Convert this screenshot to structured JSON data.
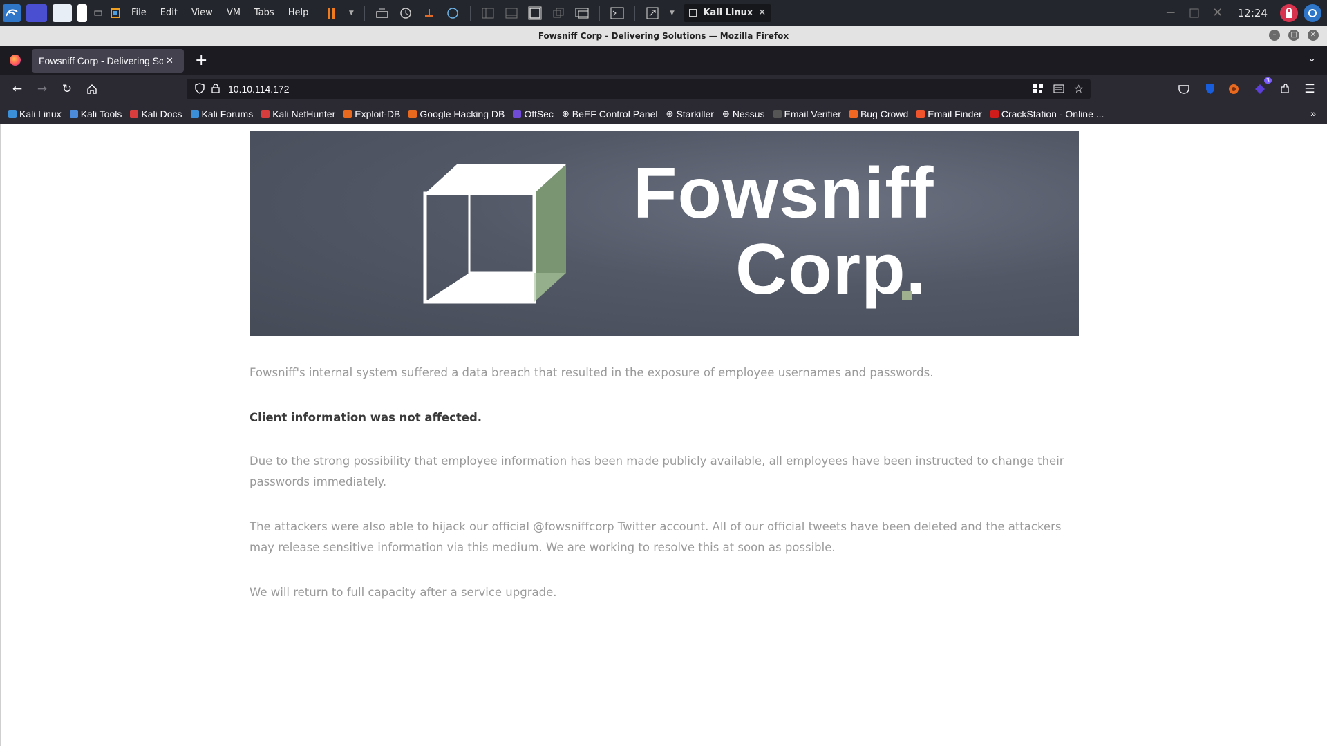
{
  "vm": {
    "menus": [
      "File",
      "Edit",
      "View",
      "VM",
      "Tabs",
      "Help"
    ],
    "tab_label": "Kali Linux",
    "clock": "12:24"
  },
  "browser": {
    "window_title": "Fowsniff Corp - Delivering Solutions — Mozilla Firefox",
    "tab_title": "Fowsniff Corp - Delivering Solutions",
    "url": "10.10.114.172",
    "extension_badge": "3",
    "bookmarks": [
      {
        "label": "Kali Linux",
        "color": "#3a8fd6"
      },
      {
        "label": "Kali Tools",
        "color": "#4b8bd9"
      },
      {
        "label": "Kali Docs",
        "color": "#d83d3d"
      },
      {
        "label": "Kali Forums",
        "color": "#3a8fd6"
      },
      {
        "label": "Kali NetHunter",
        "color": "#d83d3d"
      },
      {
        "label": "Exploit-DB",
        "color": "#e96a1f"
      },
      {
        "label": "Google Hacking DB",
        "color": "#e96a1f"
      },
      {
        "label": "OffSec",
        "color": "#6f4bd8"
      },
      {
        "label": "BeEF Control Panel",
        "color": "#cfcfcf"
      },
      {
        "label": "Starkiller",
        "color": "#cfcfcf"
      },
      {
        "label": "Nessus",
        "color": "#cfcfcf"
      },
      {
        "label": "Email Verifier",
        "color": "#555555"
      },
      {
        "label": "Bug Crowd",
        "color": "#f26722"
      },
      {
        "label": "Email Finder",
        "color": "#f0542d"
      },
      {
        "label": "CrackStation - Online ...",
        "color": "#d11c1c"
      }
    ]
  },
  "page": {
    "banner": {
      "name": "Fowsniff",
      "suffix": "Corp."
    },
    "paragraphs": [
      "Fowsniff's internal system suffered a data breach that resulted in the exposure of employee usernames and passwords.",
      "Client information was not affected.",
      "Due to the strong possibility that employee information has been made publicly available, all employees have been instructed to change their passwords immediately.",
      "The attackers were also able to hijack our official @fowsniffcorp Twitter account. All of our official tweets have been deleted and the attackers may release sensitive information via this medium. We are working to resolve this at soon as possible.",
      "We will return to full capacity after a service upgrade."
    ]
  }
}
